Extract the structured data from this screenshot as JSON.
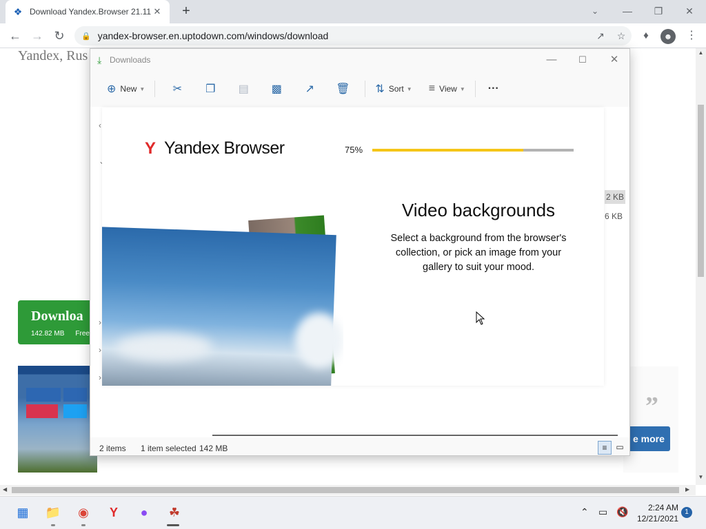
{
  "browser": {
    "tab_title": "Download Yandex.Browser 21.11",
    "url": "yandex-browser.en.uptodown.com/windows/download"
  },
  "page": {
    "bg_title": "Yandex, Rus",
    "download_button_label": "Downloa",
    "download_size": "142.82 MB",
    "download_license": "Free",
    "quote_glyph": "”",
    "more_label": "e more",
    "size_cell_1": "2 KB",
    "size_cell_2": "6 KB"
  },
  "explorer": {
    "title": "Downloads",
    "cmd_new": "New",
    "cmd_sort": "Sort",
    "cmd_view": "View",
    "cmd_more": "···",
    "status_items": "2 items",
    "status_selected": "1 item selected",
    "status_size": "142 MB"
  },
  "installer": {
    "brand_mark": "Y",
    "brand_name": "Yandex Browser",
    "progress_text": "75%",
    "progress_value": 0.75,
    "heading": "Video backgrounds",
    "body": "Select a background from the browser's collection, or pick an image from your gallery to suit your mood."
  },
  "taskbar": {
    "time": "2:24 AM",
    "date": "12/21/2021",
    "notifications": "1"
  },
  "colors": {
    "accent_green": "#2e9a38",
    "progress_yellow": "#f5c518",
    "yandex_red": "#e02a2a",
    "more_button_blue": "#2f6fb1"
  }
}
